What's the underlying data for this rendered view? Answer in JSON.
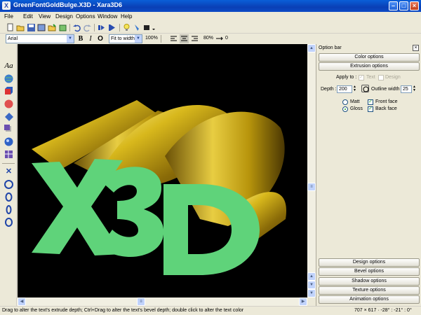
{
  "window": {
    "title": "GreenFontGoldBulge.X3D - Xara3D6",
    "app_icon_glyph": "X",
    "minimize_glyph": "–",
    "maximize_glyph": "□",
    "close_glyph": "×"
  },
  "menu": [
    "File",
    "Edit",
    "View",
    "Design",
    "Options",
    "Window",
    "Help"
  ],
  "toolbar": {
    "icons": [
      "new-icon",
      "open-icon",
      "save-icon",
      "export-icon",
      "import-icon",
      "undo-icon",
      "redo-icon",
      "play-icon",
      "animation-icon",
      "light-icon",
      "insert-icon",
      "color-icon",
      "more-icon"
    ]
  },
  "formatbar": {
    "font_name": "Arial",
    "bold": "B",
    "italic": "I",
    "outline": "O",
    "fit_mode": "Fit to width",
    "zoom": "100%",
    "line_spacing": "80%",
    "spacing": "0"
  },
  "canvas": {
    "text": "X3D",
    "colors": {
      "background": "#000000",
      "front_face": "#5fd37a",
      "extrusion": "#d8b81c"
    }
  },
  "option_bar": {
    "title": "Option bar",
    "close": "×",
    "color_options": "Color options",
    "extrusion_options": "Extrusion options",
    "apply_to_label": "Apply to :",
    "apply_text": "Text",
    "apply_design": "Design",
    "depth_label": "Depth :",
    "depth_value": "200",
    "outline_label": "Outline width :",
    "outline_value": "25",
    "matt": "Matt",
    "gloss": "Gloss",
    "front_face": "Front face",
    "back_face": "Back face",
    "design_options": "Design options",
    "bevel_options": "Bevel options",
    "shadow_options": "Shadow options",
    "texture_options": "Texture options",
    "animation_options": "Animation options"
  },
  "status": {
    "hint": "Drag to alter the text's extrude depth; Ctrl+Drag to alter the text's bevel depth; double click to alter the text color",
    "coords": "707 × 617 · -28° : -21° : 0°"
  }
}
